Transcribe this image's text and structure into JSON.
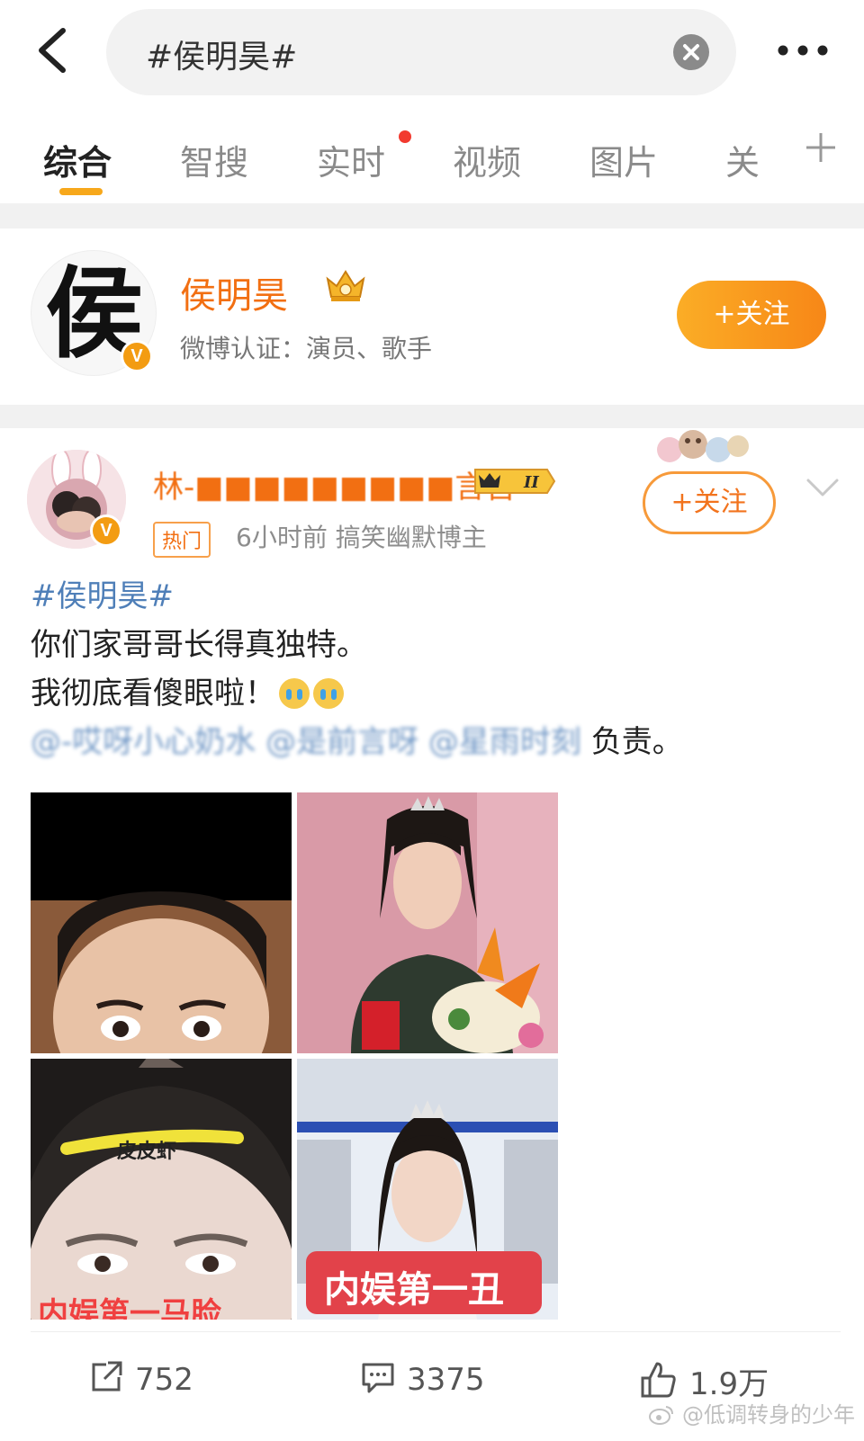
{
  "search": {
    "query": "#侯明昊#"
  },
  "tabs": [
    {
      "label": "综合",
      "active": true
    },
    {
      "label": "智搜"
    },
    {
      "label": "实时",
      "dot": true
    },
    {
      "label": "视频"
    },
    {
      "label": "图片"
    },
    {
      "label": "关"
    }
  ],
  "user_card": {
    "avatar_char": "侯",
    "verified_mark": "V",
    "name": "侯明昊",
    "verification": "微博认证：演员、歌手",
    "follow_label": "+关注"
  },
  "post": {
    "author_name": "林-■■■■■■■■■言吉",
    "level_badge": "II",
    "verified_mark": "V",
    "hot_tag": "热门",
    "meta": "6小时前   搞笑幽默博主",
    "follow_label": "+关注",
    "topic": "#侯明昊#",
    "line1": "你们家哥哥长得真独特。",
    "line2": "我彻底看傻眼啦！",
    "mentions": "@-哎呀小心奶水 @是前言呀 @星雨时刻",
    "mentions_suffix": "负责。",
    "images": [
      {
        "caption": ""
      },
      {
        "caption": ""
      },
      {
        "caption": "内娱第一马脸",
        "tag": "皮皮虾"
      },
      {
        "caption": "内娱第一丑"
      }
    ],
    "actions": {
      "reposts": "752",
      "comments": "3375",
      "likes": "1.9万"
    }
  },
  "watermark": "@低调转身的少年",
  "colors": {
    "accent_orange": "#f26f12",
    "follow_gradient_start": "#fbad26",
    "follow_gradient_end": "#f78717",
    "link_blue": "#4f7fb8",
    "tab_underline": "#f7a81b",
    "notice_dot": "#f23a2f"
  }
}
